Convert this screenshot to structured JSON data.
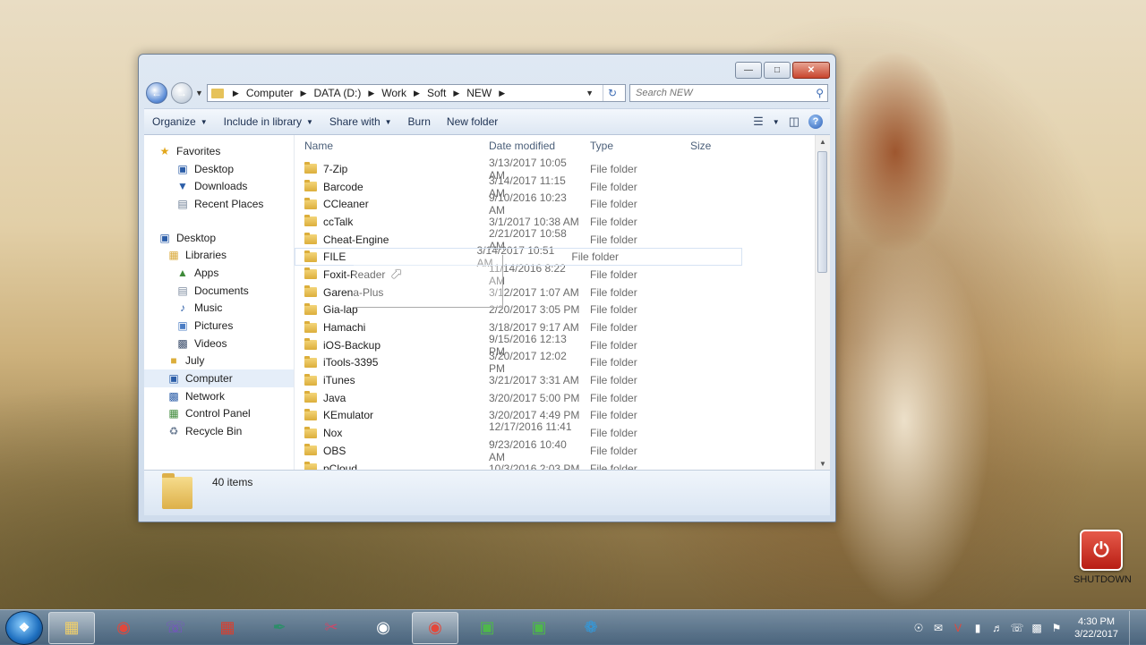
{
  "address": {
    "crumbs": [
      "Computer",
      "DATA (D:)",
      "Work",
      "Soft",
      "NEW"
    ],
    "search_placeholder": "Search NEW"
  },
  "toolbar": {
    "organize": "Organize",
    "include_in_library": "Include in library",
    "share_with": "Share with",
    "burn": "Burn",
    "new_folder": "New folder"
  },
  "nav": {
    "favorites": "Favorites",
    "fav_items": [
      "Desktop",
      "Downloads",
      "Recent Places"
    ],
    "desktop": "Desktop",
    "libraries": "Libraries",
    "library_items": [
      "Apps",
      "Documents",
      "Music",
      "Pictures",
      "Videos"
    ],
    "july": "July",
    "computer": "Computer",
    "network": "Network",
    "control_panel": "Control Panel",
    "recycle_bin": "Recycle Bin"
  },
  "columns": {
    "name": "Name",
    "date": "Date modified",
    "type": "Type",
    "size": "Size"
  },
  "files": [
    {
      "name": "7-Zip",
      "date": "3/13/2017 10:05 AM",
      "type": "File folder"
    },
    {
      "name": "Barcode",
      "date": "3/14/2017 11:15 AM",
      "type": "File folder"
    },
    {
      "name": "CCleaner",
      "date": "9/10/2016 10:23 AM",
      "type": "File folder"
    },
    {
      "name": "ccTalk",
      "date": "3/1/2017 10:38 AM",
      "type": "File folder"
    },
    {
      "name": "Cheat-Engine",
      "date": "2/21/2017 10:58 AM",
      "type": "File folder"
    },
    {
      "name": "FILE",
      "date": "3/14/2017 10:51 AM",
      "type": "File folder"
    },
    {
      "name": "Foxit-Reader",
      "date": "11/14/2016 8:22 AM",
      "type": "File folder"
    },
    {
      "name": "Garena-Plus",
      "date": "3/12/2017 1:07 AM",
      "type": "File folder"
    },
    {
      "name": "Gia-lap",
      "date": "2/20/2017 3:05 PM",
      "type": "File folder"
    },
    {
      "name": "Hamachi",
      "date": "3/18/2017 9:17 AM",
      "type": "File folder"
    },
    {
      "name": "iOS-Backup",
      "date": "9/15/2016 12:13 PM",
      "type": "File folder"
    },
    {
      "name": "iTools-3395",
      "date": "3/20/2017 12:02 PM",
      "type": "File folder"
    },
    {
      "name": "iTunes",
      "date": "3/21/2017 3:31 AM",
      "type": "File folder"
    },
    {
      "name": "Java",
      "date": "3/20/2017 5:00 PM",
      "type": "File folder"
    },
    {
      "name": "KEmulator",
      "date": "3/20/2017 4:49 PM",
      "type": "File folder"
    },
    {
      "name": "Nox",
      "date": "12/17/2016 11:41 ...",
      "type": "File folder"
    },
    {
      "name": "OBS",
      "date": "9/23/2016 10:40 AM",
      "type": "File folder"
    },
    {
      "name": "pCloud",
      "date": "10/3/2016 2:03 PM",
      "type": "File folder"
    }
  ],
  "details": {
    "count": "40 items"
  },
  "desktop": {
    "shutdown_label": "SHUTDOWN"
  },
  "taskbar": {
    "apps": [
      "folder-icon",
      "chrome-icon",
      "viber-icon",
      "tools-icon",
      "pen-icon",
      "scissors-icon",
      "eye-icon",
      "chrome-icon",
      "camtasia-icon",
      "camtasia-icon",
      "network-app-icon"
    ],
    "time": "4:30 PM",
    "date": "3/22/2017"
  }
}
